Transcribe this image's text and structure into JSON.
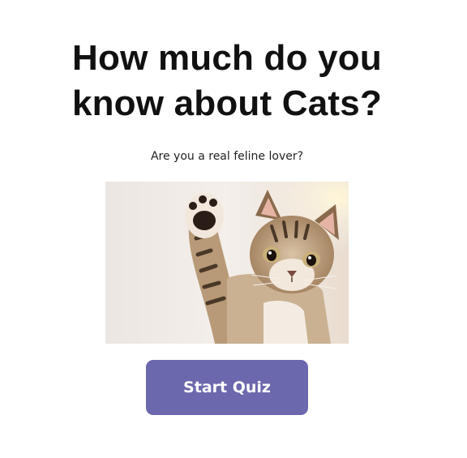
{
  "quiz": {
    "title_line1": "How much do you",
    "title_line2": "know about Cats?",
    "subtitle": "Are you a real feline lover?",
    "start_button_label": "Start Quiz"
  },
  "colors": {
    "button_background": "#6c68ad",
    "button_text": "#ffffff",
    "heading_text": "#111111"
  }
}
